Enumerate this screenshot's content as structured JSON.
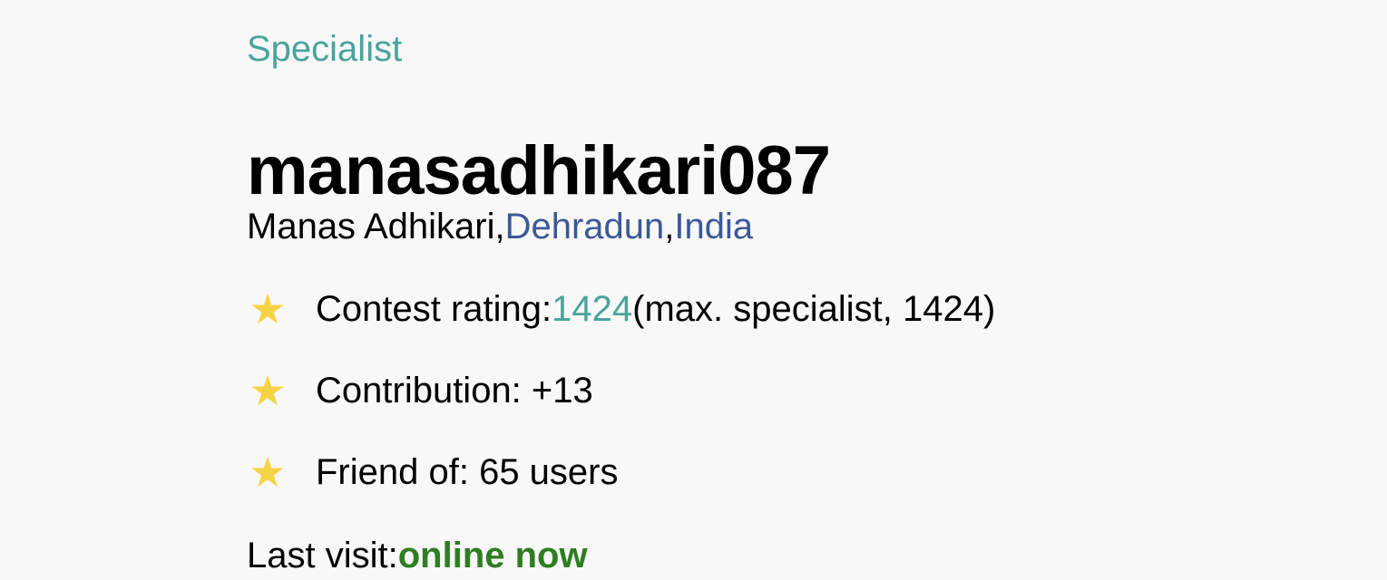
{
  "profile": {
    "rank": "Specialist",
    "handle": "manasadhikari087",
    "name": "Manas Adhikari",
    "city": "Dehradun",
    "country": "India",
    "separator": ",",
    "contest_rating": {
      "label": "Contest rating:",
      "value": "1424",
      "max_text": "(max. specialist, 1424)"
    },
    "contribution": "Contribution: +13",
    "friends": "Friend of: 65 users",
    "last_visit": {
      "label": "Last visit:",
      "value": "online now"
    }
  },
  "icons": {
    "rating": "star-icon",
    "contribution": "star-icon",
    "friends": "star-icon"
  },
  "colors": {
    "background": "#f8f8f8",
    "specialist": "#4aa39b",
    "link": "#3b5998",
    "star": "#f6d346",
    "online": "#2f7d22"
  }
}
